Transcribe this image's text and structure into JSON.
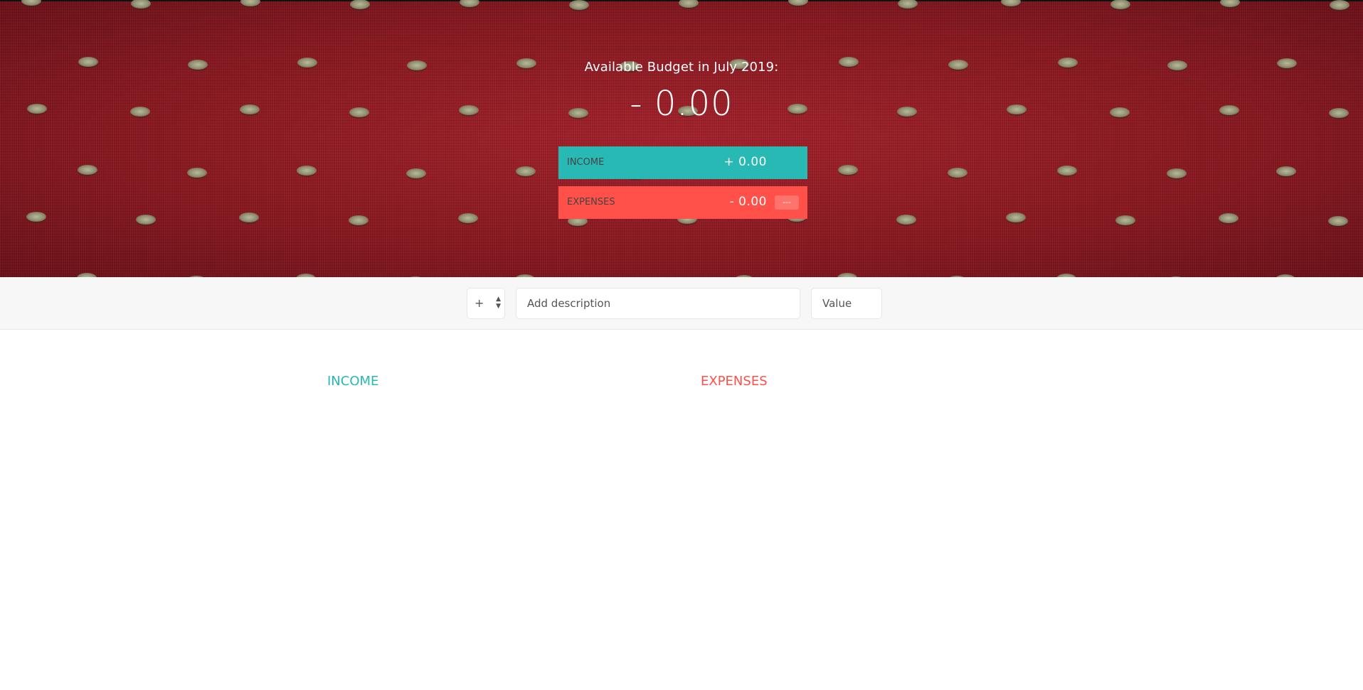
{
  "budget": {
    "title": "Available Budget in July 2019:",
    "value": "- 0.00"
  },
  "summary": {
    "income": {
      "label": "INCOME",
      "value": "+ 0.00"
    },
    "expenses": {
      "label": "EXPENSES",
      "value": "- 0.00",
      "percentage": "---"
    }
  },
  "add": {
    "type_value": "+",
    "description_placeholder": "Add description",
    "value_placeholder": "Value"
  },
  "lists": {
    "income_title": "INCOME",
    "expenses_title": "EXPENSES"
  },
  "colors": {
    "income": "#28b9b5",
    "expenses": "#ff5049",
    "header_bg": "#8e1a22"
  }
}
